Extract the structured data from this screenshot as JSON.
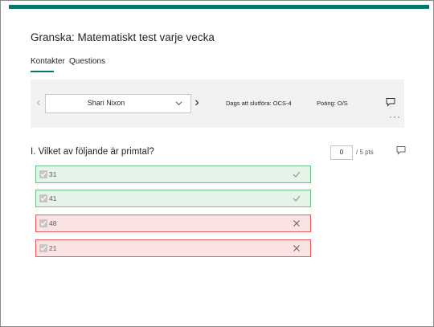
{
  "form": {
    "title": "Granska: Matematiskt test varje vecka"
  },
  "tabs": [
    {
      "label": "Kontakter",
      "active": true
    },
    {
      "label": "Questions",
      "active": false
    }
  ],
  "respondent": {
    "name": "Shari Nixon",
    "due": "Dags att slutföra: OCS-4",
    "score": "Poäng: O/S"
  },
  "question": {
    "title": "I. Vilket av följande är primtal?",
    "points_value": "0",
    "points_total": "/ 5 pts",
    "options": [
      {
        "label": "31",
        "status": "correct"
      },
      {
        "label": "41",
        "status": "correct"
      },
      {
        "label": "48",
        "status": "wrong"
      },
      {
        "label": "21",
        "status": "wrong"
      }
    ]
  },
  "colors": {
    "accent": "#077568",
    "correct_border": "#6cbf86",
    "correct_fill": "#e6f3e9",
    "wrong_border": "#e45b5b",
    "wrong_fill": "#fbe3e3"
  },
  "icons": {
    "prev": "chevron-left-icon",
    "next": "chevron-right-icon",
    "dropdown": "chevron-down-icon",
    "comment": "comment-icon",
    "more": "more-icon",
    "correct": "checkmark-icon",
    "wrong": "x-icon"
  }
}
